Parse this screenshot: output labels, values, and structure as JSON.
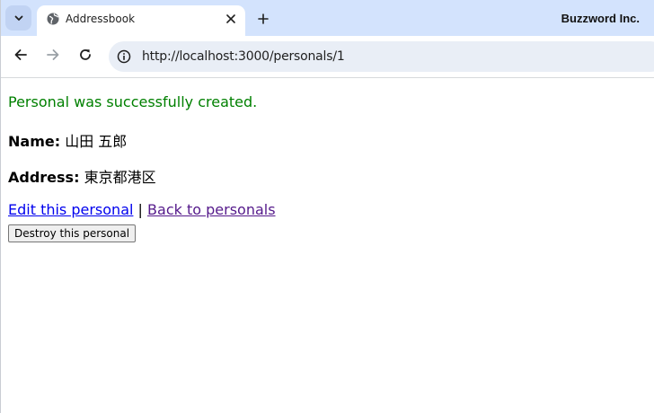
{
  "browser": {
    "tab": {
      "title": "Addressbook",
      "favicon": "globe-icon",
      "close_icon": "close-icon"
    },
    "tab_list_icon": "chevron-down-icon",
    "new_tab_icon": "plus-icon",
    "profile_name": "Buzzword Inc.",
    "nav": {
      "back_icon": "arrow-left-icon",
      "forward_icon": "arrow-right-icon",
      "reload_icon": "reload-icon"
    },
    "address_bar": {
      "site_info_icon": "info-icon",
      "url": "http://localhost:3000/personals/1"
    }
  },
  "page": {
    "notice": "Personal was successfully created.",
    "name_label": "Name:",
    "name_value": "山田 五郎",
    "address_label": "Address:",
    "address_value": "東京都港区",
    "edit_link": "Edit this personal",
    "separator": "|",
    "back_link": "Back to personals",
    "destroy_button": "Destroy this personal"
  },
  "colors": {
    "tabstrip": "#d3e3fd",
    "notice_green": "#008000",
    "link_unvisited": "#0000ee",
    "link_visited": "#551a8b"
  }
}
